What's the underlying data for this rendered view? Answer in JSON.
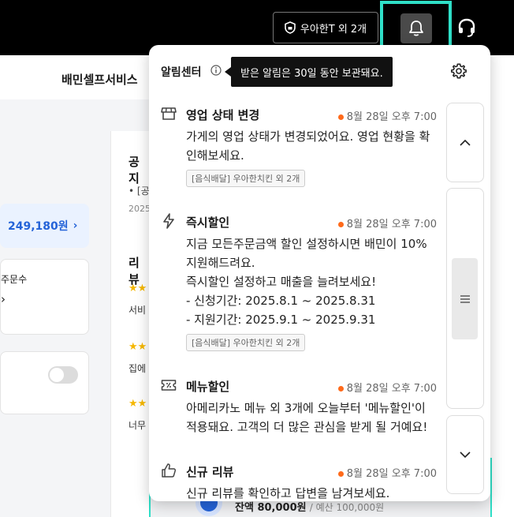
{
  "topbar": {
    "store_selector": "우아한T 외 2개",
    "icons": {
      "store": "shield-store-icon",
      "bell": "bell-icon",
      "support": "headset-icon"
    },
    "colors": {
      "background": "#000000",
      "highlight": "#2fe0c8"
    }
  },
  "background": {
    "title": "배민셀프서비스",
    "amount": "249,180원",
    "amount_chevron": "›",
    "order_count_label": "주문수",
    "chevron": "›",
    "notice_heading": "공지",
    "notice_item": "• [공",
    "notice_date": "2025",
    "review_heading": "리뷰",
    "review1": "서비",
    "review2": "집에",
    "review3": "너무",
    "bottom_amount": "잔액 80,000원",
    "bottom_budget": "예산 100,000원"
  },
  "panel": {
    "title": "알림센터",
    "tooltip": "받은 알림은 30일 동안 보관돼요.",
    "items": [
      {
        "icon": "store-icon",
        "title": "영업 상태 변경",
        "time": "8월 28일 오후 7:00",
        "body": [
          "가게의 영업 상태가 변경되었어요. 영업 현황을 확",
          "인해보세요."
        ],
        "tag": "[음식배달] 우아한치킨 외 2개"
      },
      {
        "icon": "lightning-icon",
        "title": "즉시할인",
        "time": "8월 28일 오후 7:00",
        "body": [
          "지금 모든주문금액 할인 설정하시면 배민이 10%",
          "지원해드려요.",
          "즉시할인 설정하고 매출을 늘려보세요!",
          "- 신청기간: 2025.8.1 ~ 2025.8.31",
          "- 지원기간: 2025.9.1 ~ 2025.9.31"
        ],
        "tag": "[음식배달] 우아한치킨 외 2개"
      },
      {
        "icon": "discount-ticket-icon",
        "title": "메뉴할인",
        "time": "8월 28일 오후 7:00",
        "body": [
          "아메리카노 메뉴 외 3개에 오늘부터 '메뉴할인'이",
          "적용돼요. 고객의 더 많은 관심을 받게 될 거예요!"
        ],
        "tag": ""
      },
      {
        "icon": "thumbs-up-icon",
        "title": "신규 리뷰",
        "time": "8월 28일 오후 7:00",
        "body": [
          "신규 리뷰를 확인하고 답변을 남겨보세요."
        ],
        "tag": ""
      }
    ],
    "scroll": {
      "up": "scroll-up-icon",
      "down": "scroll-down-icon",
      "thumb": "menu-lines-icon"
    },
    "colors": {
      "dot": "#ff6a1a",
      "tooltip_bg": "#111111"
    }
  }
}
